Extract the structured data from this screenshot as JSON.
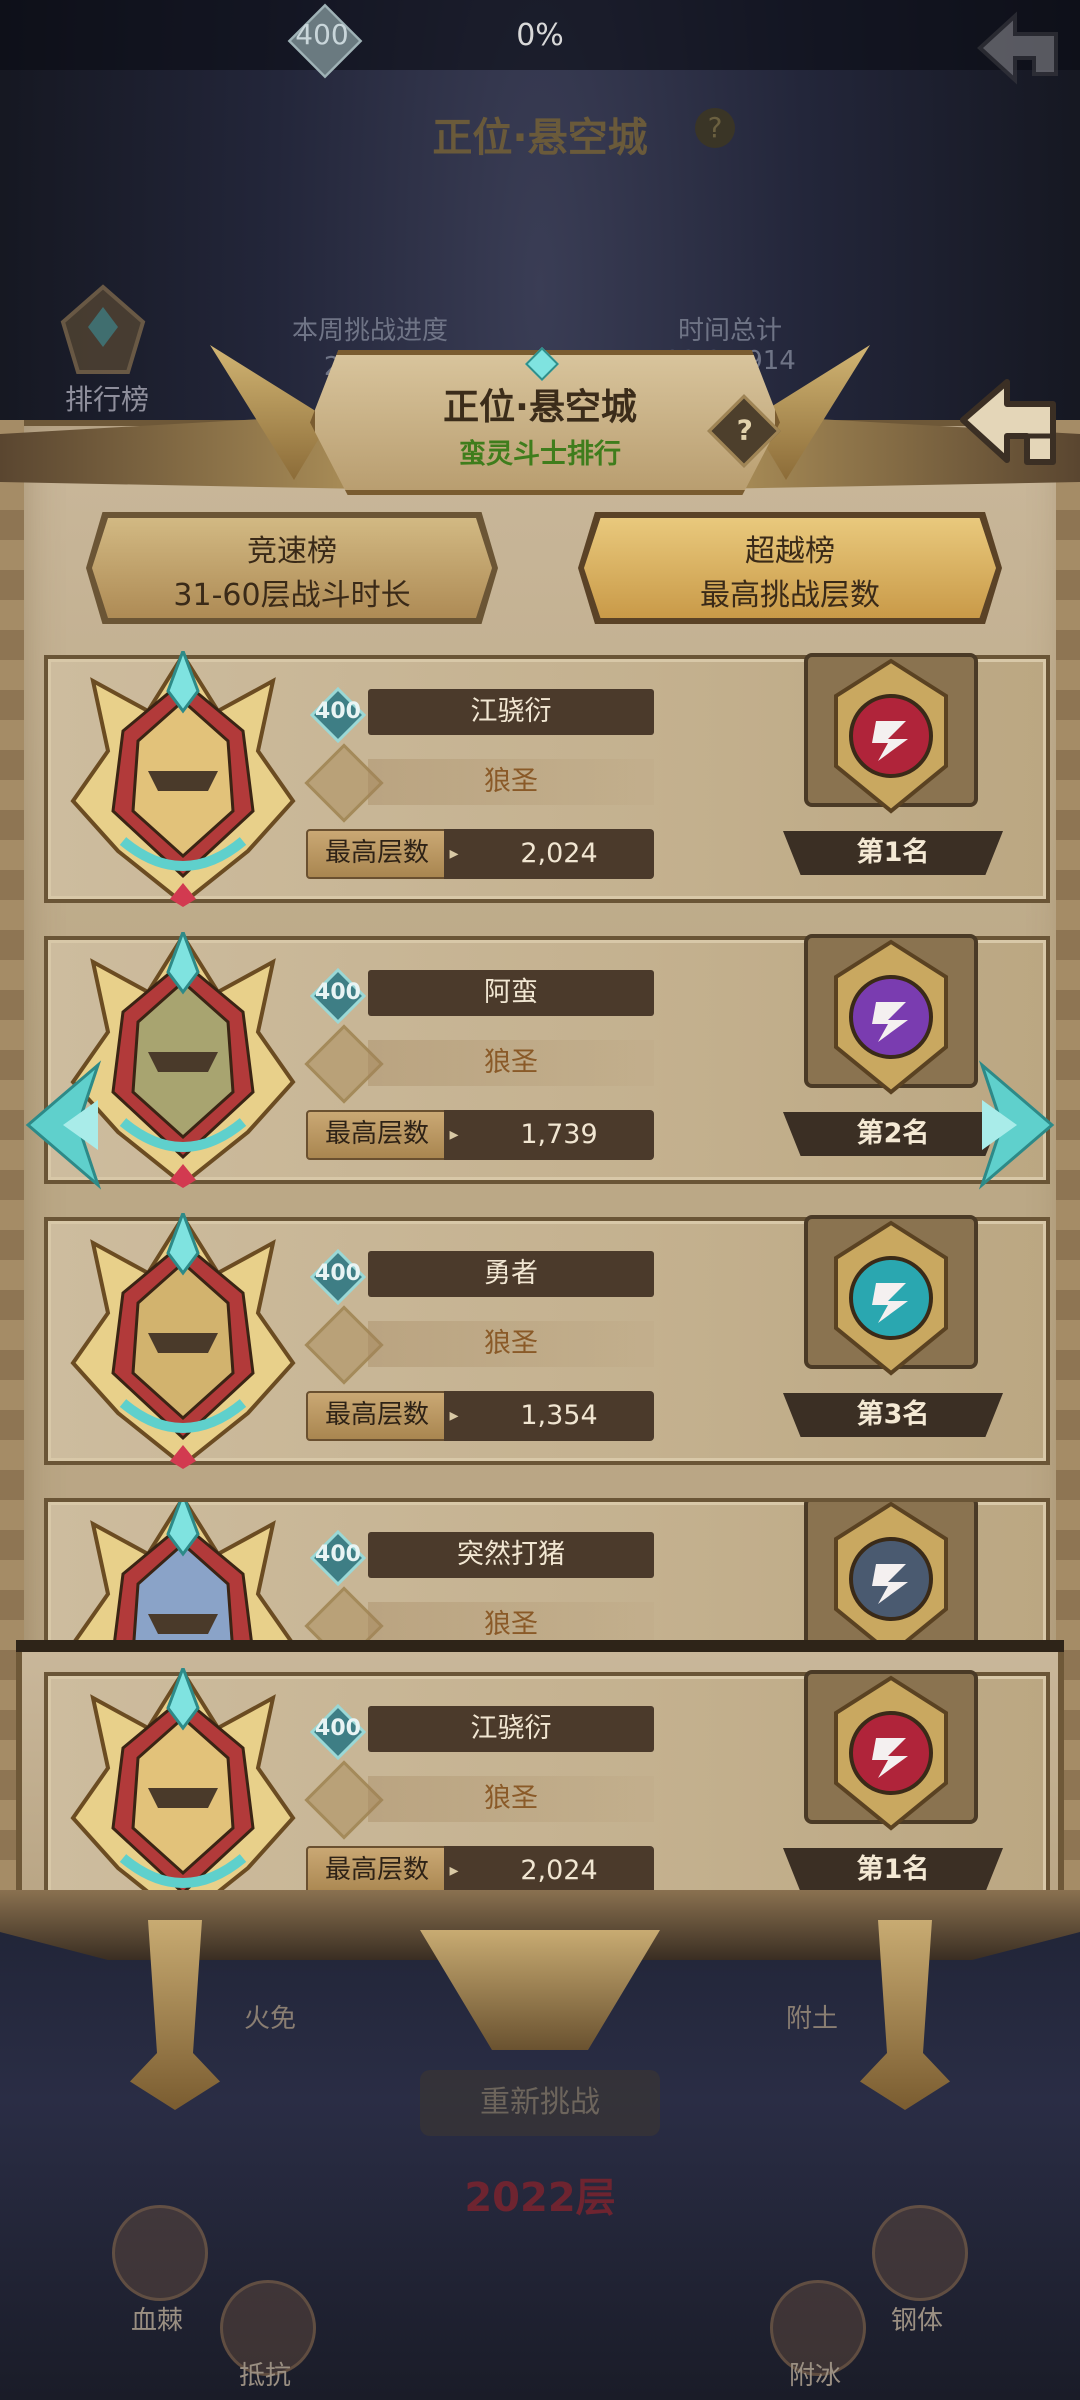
{
  "background": {
    "top_level": "400",
    "top_progress": "0%",
    "title": "正位·悬空城",
    "help": "?",
    "rank_label": "排行榜",
    "week_progress_label": "本周挑战进度",
    "week_progress_value": "2024层",
    "time_total_label": "时间总计",
    "time_total_value": "03:34'914",
    "element_fire": "火免",
    "element_earth": "附土",
    "retry_button": "重新挑战",
    "current_floor": "2022层",
    "skills": [
      "血棘",
      "抵抗",
      "钢体",
      "附冰"
    ]
  },
  "header": {
    "title": "正位·悬空城",
    "subtitle": "蛮灵斗士排行",
    "help": "?"
  },
  "tabs": [
    {
      "title": "竞速榜",
      "subtitle": "31-60层战斗时长",
      "selected": false
    },
    {
      "title": "超越榜",
      "subtitle": "最高挑战层数",
      "selected": true
    }
  ],
  "best_label": "最高层数",
  "rows": [
    {
      "level": "400",
      "name": "江骁衍",
      "guild": "狼圣",
      "best": "2,024",
      "rank": "第1名",
      "medal_color": "#b0243a",
      "portrait_tone": "#e2c27a"
    },
    {
      "level": "400",
      "name": "阿蛮",
      "guild": "狼圣",
      "best": "1,739",
      "rank": "第2名",
      "medal_color": "#7a3cb0",
      "portrait_tone": "#a8a470"
    },
    {
      "level": "400",
      "name": "勇者",
      "guild": "狼圣",
      "best": "1,354",
      "rank": "第3名",
      "medal_color": "#2aa7b0",
      "portrait_tone": "#d2b36e"
    },
    {
      "level": "400",
      "name": "突然打猪",
      "guild": "狼圣",
      "best": "",
      "rank": "",
      "medal_color": "#4a5a70",
      "portrait_tone": "#8aa3c8"
    }
  ],
  "my_rank": {
    "level": "400",
    "name": "江骁衍",
    "guild": "狼圣",
    "best": "2,024",
    "rank": "第1名",
    "medal_color": "#b0243a",
    "portrait_tone": "#e2c27a"
  },
  "colors": {
    "accent_teal": "#5fd0cc",
    "panel": "#c4b18f",
    "dark_plate": "#4b3a2b",
    "guild_text": "#8a5a28",
    "subtitle_green": "#3f7d1c"
  }
}
